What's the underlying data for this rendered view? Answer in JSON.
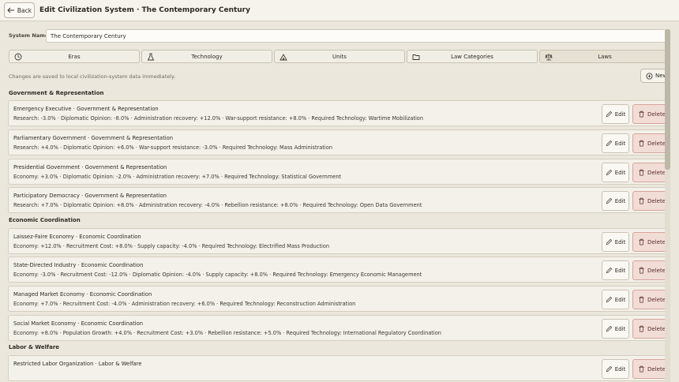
{
  "header": {
    "back_label": "Back",
    "title": "Edit Civilization System · The Contemporary Century"
  },
  "system_name": {
    "label": "System Name",
    "value": "The Contemporary Century"
  },
  "tabs": [
    {
      "label": "Eras",
      "icon": "clock-icon"
    },
    {
      "label": "Technology",
      "icon": "flask-icon"
    },
    {
      "label": "Units",
      "icon": "tent-icon"
    },
    {
      "label": "Law Categories",
      "icon": "folder-icon"
    },
    {
      "label": "Laws",
      "icon": "scale-icon"
    }
  ],
  "save_note": "Changes are saved to local civilization-system data immediately.",
  "new_button_label": "New",
  "edit_label": "Edit",
  "delete_label": "Delete",
  "sections": [
    {
      "title": "Government & Representation",
      "laws": [
        {
          "title": "Emergency Executive  ·  Government & Representation",
          "detail": "Research: -3.0% · Diplomatic Opinion: -8.0% · Administration recovery: +12.0% · War-support resistance: +8.0% · Required Technology: Wartime Mobilization"
        },
        {
          "title": "Parliamentary Government  ·  Government & Representation",
          "detail": "Research: +4.0% · Diplomatic Opinion: +6.0% · War-support resistance: -3.0% · Required Technology: Mass Administration"
        },
        {
          "title": "Presidential Government  ·  Government & Representation",
          "detail": "Economy: +3.0% · Diplomatic Opinion: -2.0% · Administration recovery: +7.0% · Required Technology: Statistical Government"
        },
        {
          "title": "Participatory Democracy  ·  Government & Representation",
          "detail": "Research: +7.0% · Diplomatic Opinion: +8.0% · Administration recovery: -4.0% · Rebellion resistance: +8.0% · Required Technology: Open Data Government"
        }
      ]
    },
    {
      "title": "Economic Coordination",
      "laws": [
        {
          "title": "Laissez-Faire Economy  ·  Economic Coordination",
          "detail": "Economy: +12.0% · Recruitment Cost: +8.0% · Supply capacity: -4.0% · Required Technology: Electrified Mass Production"
        },
        {
          "title": "State-Directed Industry  ·  Economic Coordination",
          "detail": "Economy: -3.0% · Recruitment Cost: -12.0% · Diplomatic Opinion: -4.0% · Supply capacity: +8.0% · Required Technology: Emergency Economic Management"
        },
        {
          "title": "Managed Market Economy  ·  Economic Coordination",
          "detail": "Economy: +7.0% · Recruitment Cost: -4.0% · Administration recovery: +6.0% · Required Technology: Reconstruction Administration"
        },
        {
          "title": "Social Market Economy  ·  Economic Coordination",
          "detail": "Economy: +8.0% · Population Growth: +4.0% · Recruitment Cost: +3.0% · Rebellion resistance: +5.0% · Required Technology: International Regulatory Coordination"
        }
      ]
    },
    {
      "title": "Labor & Welfare",
      "laws": [
        {
          "title": "Restricted Labor Organization  ·  Labor & Welfare",
          "detail": ""
        }
      ]
    }
  ]
}
